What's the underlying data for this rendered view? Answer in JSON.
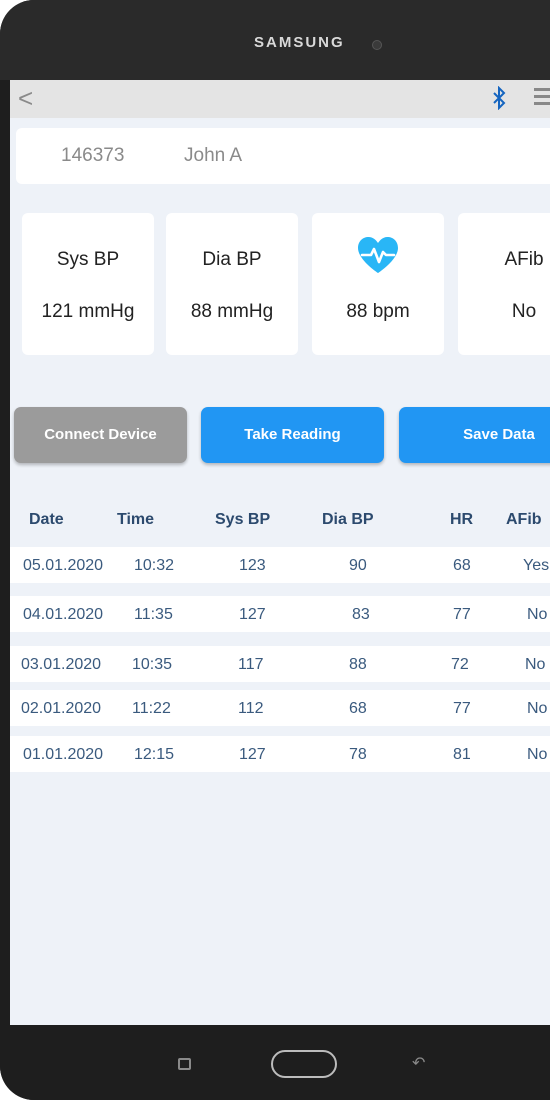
{
  "device": {
    "brand": "SAMSUNG"
  },
  "actionbar": {
    "back_icon": "chevron-left-icon",
    "bluetooth_icon": "bluetooth-icon",
    "menu_icon": "hamburger-menu-icon"
  },
  "patient": {
    "id": "146373",
    "name": "John A"
  },
  "vitals": [
    {
      "label": "Sys BP",
      "value": "121 mmHg"
    },
    {
      "label": "Dia BP",
      "value": "88 mmHg"
    },
    {
      "label": "heart-rate-icon",
      "value": "88 bpm"
    },
    {
      "label": "AFib",
      "value": "No"
    }
  ],
  "buttons": {
    "connect": "Connect Device",
    "take_reading": "Take Reading",
    "save": "Save Data"
  },
  "table": {
    "headers": [
      "Date",
      "Time",
      "Sys BP",
      "Dia BP",
      "HR",
      "AFib"
    ],
    "rows": [
      [
        "05.01.2020",
        "10:32",
        "123",
        "90",
        "68",
        "Yes"
      ],
      [
        "04.01.2020",
        "11:35",
        "127",
        "83",
        "77",
        "No"
      ],
      [
        "03.01.2020",
        "10:35",
        "117",
        "88",
        "72",
        "No"
      ],
      [
        "02.01.2020",
        "11:22",
        "112",
        "68",
        "77",
        "No"
      ],
      [
        "01.01.2020",
        "12:15",
        "127",
        "78",
        "81",
        "No"
      ]
    ]
  },
  "colors": {
    "accent": "#2196f3",
    "disabled": "#9b9b9b",
    "heart": "#29b6f6",
    "table_text": "#3a5a7e"
  }
}
